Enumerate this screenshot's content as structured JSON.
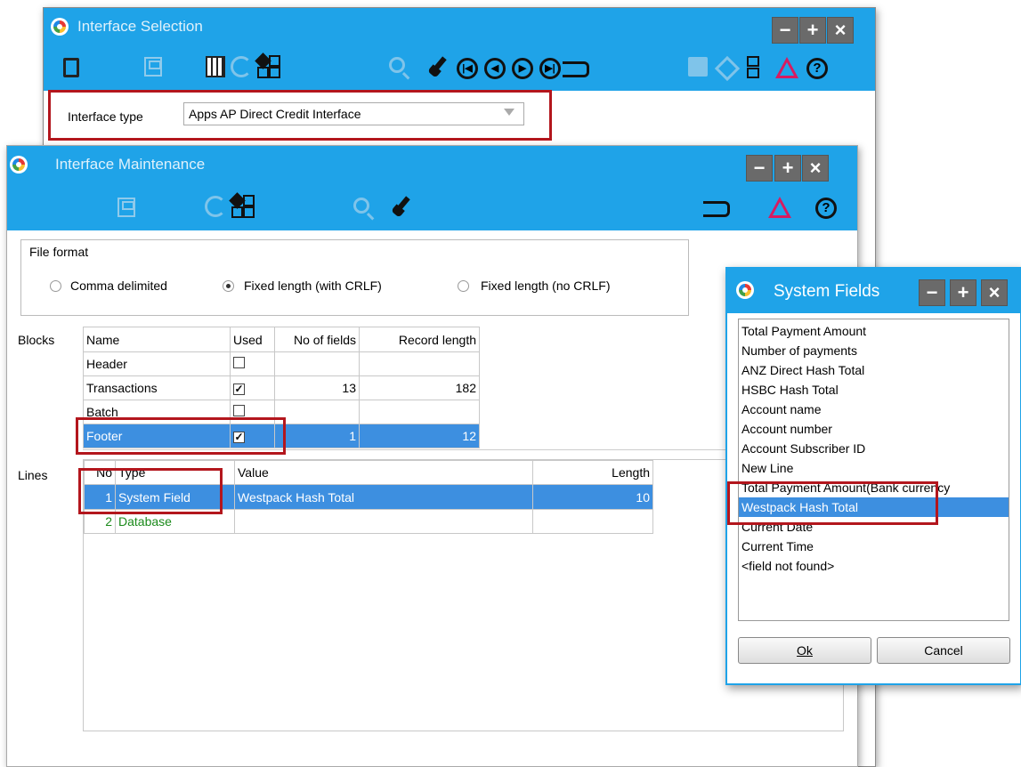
{
  "interface_selection": {
    "title": "Interface Selection",
    "interface_type_label": "Interface type",
    "interface_type_value": "Apps AP Direct Credit Interface",
    "window_buttons": [
      "−",
      "+",
      "×"
    ]
  },
  "interface_maintenance": {
    "title": "Interface Maintenance",
    "window_buttons": [
      "−",
      "+",
      "×"
    ],
    "file_format": {
      "label": "File format",
      "options": [
        {
          "label": "Comma delimited",
          "selected": false
        },
        {
          "label": "Fixed length  (with CRLF)",
          "selected": true
        },
        {
          "label": "Fixed length  (no CRLF)",
          "selected": false
        }
      ]
    },
    "blocks": {
      "label": "Blocks",
      "headers": [
        "Name",
        "Used",
        "No of fields",
        "Record length"
      ],
      "rows": [
        {
          "name": "Header",
          "used": false,
          "fields": "",
          "length": ""
        },
        {
          "name": "Transactions",
          "used": true,
          "fields": "13",
          "length": "182"
        },
        {
          "name": "Batch",
          "used": false,
          "fields": "",
          "length": ""
        },
        {
          "name": "Footer",
          "used": true,
          "fields": "1",
          "length": "12"
        }
      ]
    },
    "lines": {
      "label": "Lines",
      "headers": [
        "No",
        "Type",
        "Value",
        "Length"
      ],
      "rows": [
        {
          "no": "1",
          "type": "System Field",
          "value": "Westpack Hash Total",
          "length": "10"
        },
        {
          "no": "2",
          "type": "Database",
          "value": "",
          "length": ""
        }
      ]
    }
  },
  "system_fields": {
    "title": "System Fields",
    "window_buttons": [
      "−",
      "+",
      "×"
    ],
    "items": [
      "Total Payment Amount",
      "Number of payments",
      "ANZ Direct Hash Total",
      "HSBC Hash Total",
      "Account name",
      "Account number",
      "Account Subscriber ID",
      "New Line",
      "Total Payment Amount(Bank currency",
      "Westpack Hash Total",
      "Current Date",
      "Current Time",
      "<field not found>"
    ],
    "selected_index": 9,
    "ok_label": "Ok",
    "cancel_label": "Cancel"
  },
  "icons": {
    "toolbar_1": [
      "new-page-icon",
      "save-icon",
      "delete-bin-icon",
      "refresh-icon",
      "layout-grid-icon",
      "search-icon",
      "clear-brush-icon",
      "first-record-icon",
      "previous-record-icon",
      "next-record-icon",
      "last-record-icon",
      "point-hand-icon",
      "note-icon",
      "tag-icon",
      "columns-icon",
      "alert-icon",
      "help-icon"
    ],
    "toolbar_2": [
      "save-icon",
      "refresh-icon",
      "layout-grid-icon",
      "search-icon",
      "clear-brush-icon",
      "point-hand-icon",
      "alert-icon",
      "help-icon"
    ]
  },
  "colors": {
    "titlebar": "#1fa3e8",
    "selection": "#3d8fe0",
    "highlight_box": "#b3161d",
    "database_row_text": "#1b8a1b"
  }
}
